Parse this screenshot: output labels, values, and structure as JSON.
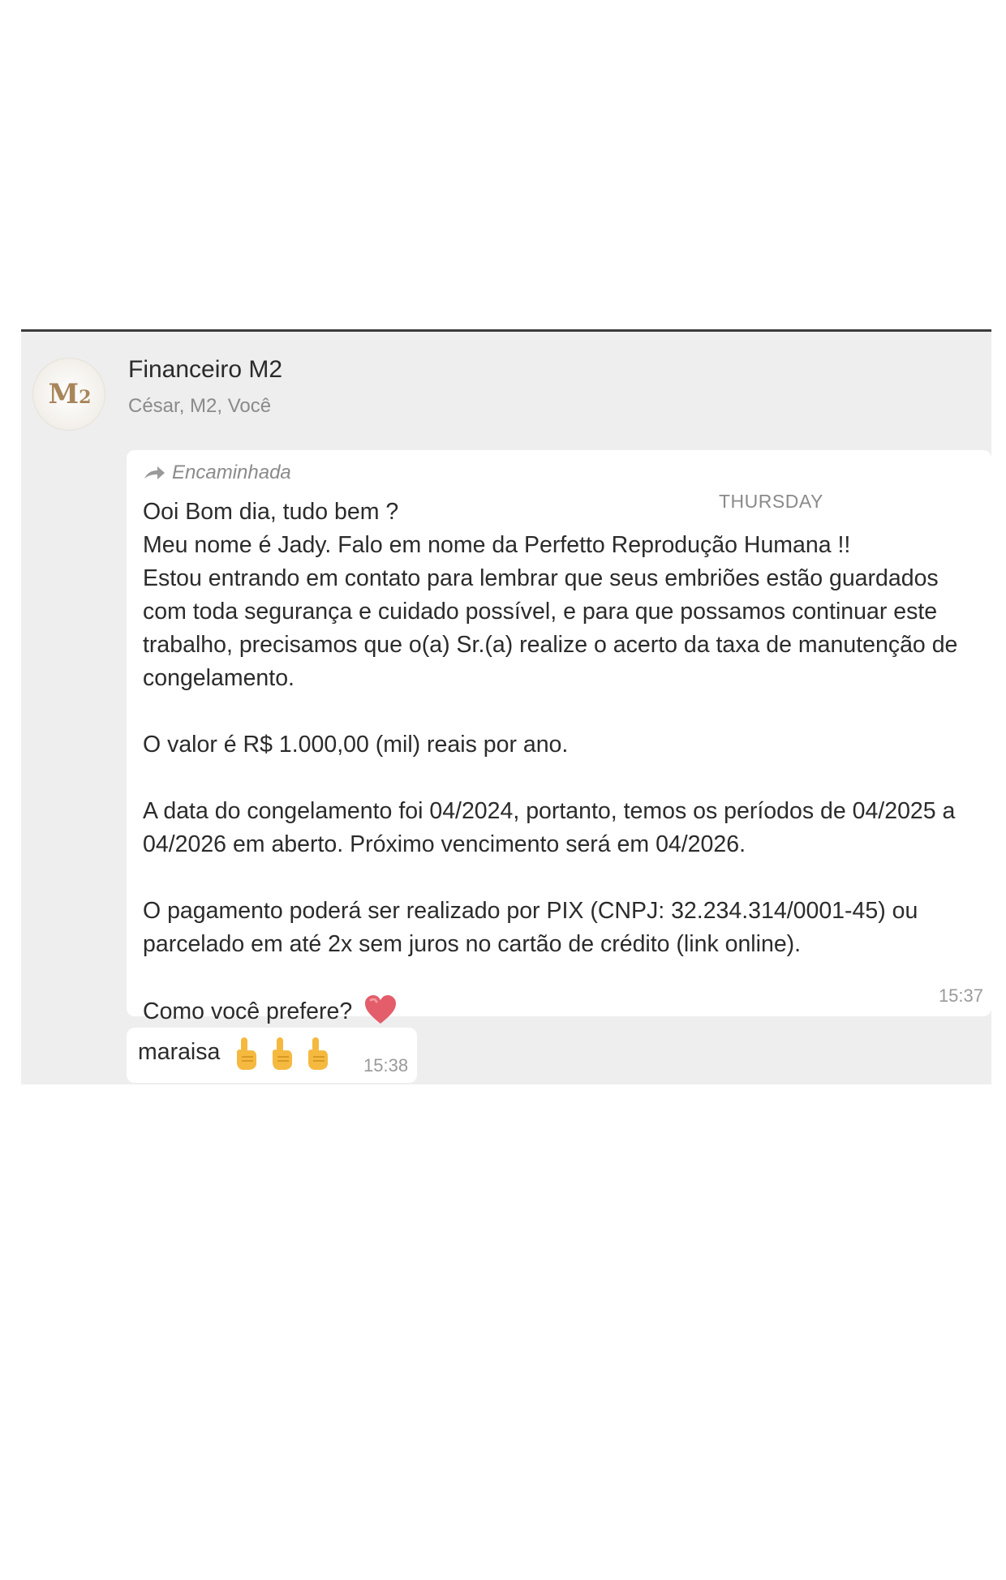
{
  "chat": {
    "avatar_label": "M2",
    "title": "Financeiro M2",
    "members": "César, M2, Você"
  },
  "message": {
    "forwarded_label": "Encaminhada",
    "day_label": "THURSDAY",
    "lines": {
      "l1": "Ooi Bom dia, tudo bem ?",
      "l2": "Meu nome é Jady. Falo em nome da Perfetto Reprodução Humana !!",
      "l3": "Estou entrando em contato para lembrar que seus embriões estão guardados com toda segurança e cuidado possível, e para que possamos continuar este trabalho, precisamos que o(a) Sr.(a) realize o acerto da taxa de manutenção de congelamento.",
      "l4": "O valor é R$ 1.000,00 (mil) reais por ano.",
      "l5": "A data do congelamento foi 04/2024, portanto, temos os períodos de 04/2025 a 04/2026 em aberto. Próximo vencimento será em 04/2026.",
      "l6": "O pagamento poderá ser realizado por PIX (CNPJ: 32.234.314/0001-45) ou parcelado em até 2x sem juros no cartão de crédito (link online).",
      "l7": "Como você prefere?"
    },
    "time": "15:37",
    "heart_icon": "red-heart-icon"
  },
  "reply": {
    "text": "maraisa",
    "icons": [
      "pointing-up-finger-icon",
      "pointing-up-finger-icon",
      "pointing-up-finger-icon"
    ],
    "time": "15:38"
  },
  "colors": {
    "chat_background": "#eeeeee",
    "bubble": "#ffffff",
    "heart": "#e35d6a",
    "finger": "#f5b940"
  }
}
